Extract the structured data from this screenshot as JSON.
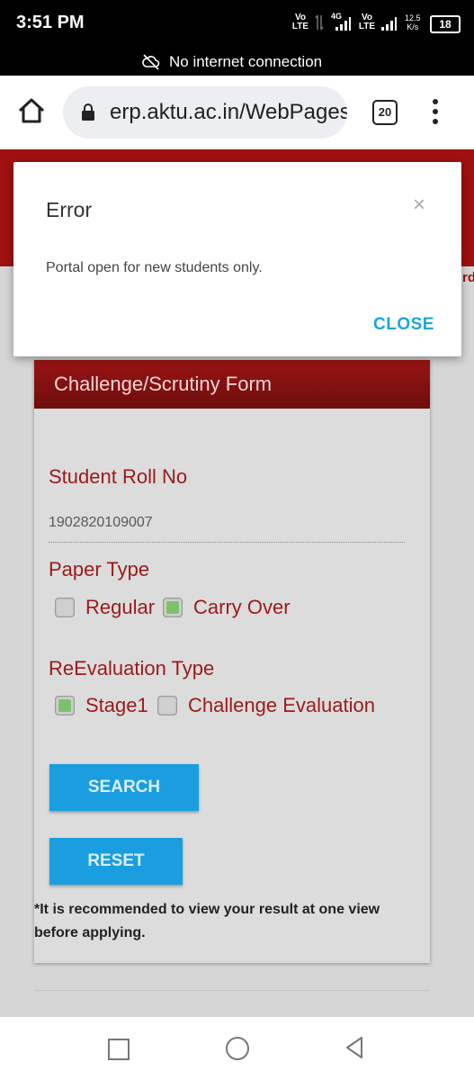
{
  "status_bar": {
    "time": "3:51 PM",
    "sim1": "Vo LTE",
    "data_type": "4G",
    "sim2": "Vo LTE",
    "speed_value": "12.5",
    "speed_unit": "K/s",
    "battery": "18"
  },
  "network_banner": {
    "text": "No internet connection",
    "icon": "cloud-off-icon"
  },
  "browser": {
    "url": "erp.aktu.ac.in/WebPages",
    "tab_count": "20"
  },
  "page": {
    "edge_text": "rd",
    "form": {
      "title": "Challenge/Scrutiny Form",
      "roll_label": "Student Roll No",
      "roll_value": "1902820109007",
      "paper_type_label": "Paper Type",
      "paper_options": [
        {
          "label": "Regular",
          "checked": false
        },
        {
          "label": "Carry Over",
          "checked": true
        }
      ],
      "reeval_label": "ReEvaluation Type",
      "reeval_options": [
        {
          "label": "Stage1",
          "checked": true
        },
        {
          "label": "Challenge Evaluation",
          "checked": false
        }
      ],
      "search_label": "SEARCH",
      "reset_label": "RESET",
      "note": "*It is recommended to view your result at one view before applying."
    }
  },
  "dialog": {
    "title": "Error",
    "close_x": "×",
    "message": "Portal open for new students only.",
    "close_label": "CLOSE"
  },
  "colors": {
    "brand_red": "#a01010",
    "button_blue": "#1a9ee0",
    "checked_green": "#7cc26b",
    "close_link": "#1aa6d8"
  }
}
